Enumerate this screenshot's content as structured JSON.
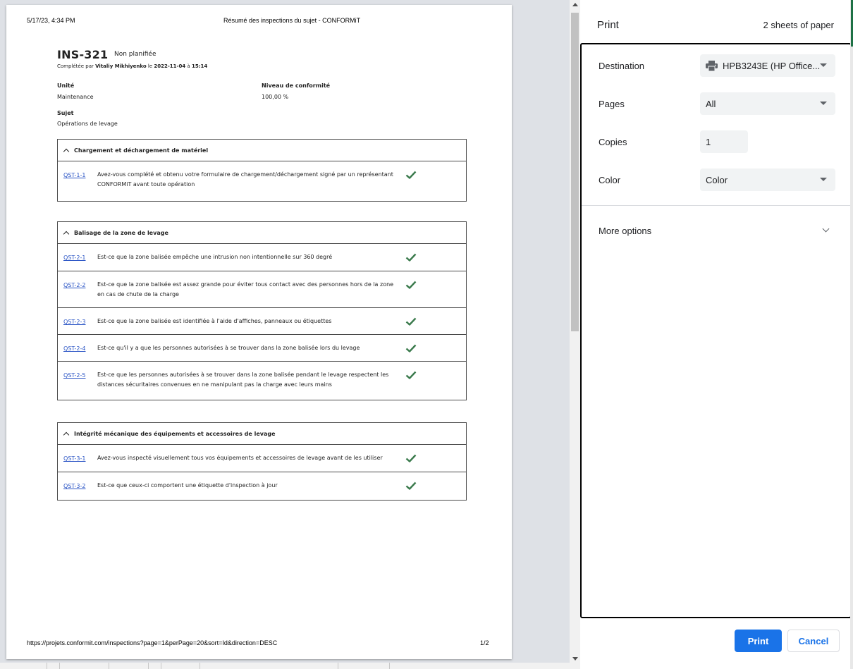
{
  "preview": {
    "header_date": "5/17/23, 4:34 PM",
    "header_title": "Résumé des inspections du sujet - CONFORMiT",
    "footer_url": "https://projets.conformit.com/inspections?page=1&perPage=20&sort=Id&direction=DESC",
    "footer_page": "1/2",
    "inspection": {
      "id": "INS-321",
      "status": "Non planifiée",
      "completed_prefix": "Complétée par",
      "completed_by": "Vitaliy Mikhiyenko",
      "completed_on": "le",
      "date": "2022-11-04",
      "at": "à",
      "time": "15:14",
      "unit_label": "Unité",
      "unit_value": "Maintenance",
      "conformity_label": "Niveau de conformité",
      "conformity_value": "100,00 %",
      "subject_label": "Sujet",
      "subject_value": "Opérations de levage"
    },
    "sections": [
      {
        "title": "Chargement et déchargement de matériel",
        "questions": [
          {
            "code": "QST-1-1",
            "text": "Avez-vous complété et obtenu votre formulaire de chargement/déchargement signé par un représentant CONFORMiT avant toute opération"
          }
        ]
      },
      {
        "title": "Balisage de la zone de levage",
        "questions": [
          {
            "code": "QST-2-1",
            "text": "Est-ce que la zone balisée empêche une intrusion non intentionnelle sur 360 degré"
          },
          {
            "code": "QST-2-2",
            "text": "Est-ce que la zone balisée est assez grande pour éviter tous contact avec des personnes hors de la zone en cas de chute de la charge"
          },
          {
            "code": "QST-2-3",
            "text": "Est-ce que la zone balisée est identifiée à l'aide d'affiches, panneaux ou étiquettes"
          },
          {
            "code": "QST-2-4",
            "text": "Est-ce qu'il y a que les personnes autorisées à se trouver dans la zone balisée lors du levage"
          },
          {
            "code": "QST-2-5",
            "text": "Est-ce que les personnes autorisées à se trouver dans la zone balisée pendant le levage respectent les distances sécuritaires convenues en ne manipulant pas la charge avec leurs mains"
          }
        ]
      },
      {
        "title": "Intégrité mécanique des équipements et accessoires de levage",
        "questions": [
          {
            "code": "QST-3-1",
            "text": "Avez-vous inspecté visuellement tous vos équipements et accessoires de levage avant de les utiliser"
          },
          {
            "code": "QST-3-2",
            "text": "Est-ce que ceux-ci comportent une étiquette d'inspection à jour"
          }
        ]
      }
    ],
    "check_icon": "check-icon",
    "check_color": "#3a7a4c"
  },
  "print_panel": {
    "title": "Print",
    "sheets": "2 sheets of paper",
    "destination_label": "Destination",
    "destination_value": "HPB3243E (HP Office...",
    "destination_icon": "printer-icon",
    "pages_label": "Pages",
    "pages_value": "All",
    "copies_label": "Copies",
    "copies_value": "1",
    "color_label": "Color",
    "color_value": "Color",
    "more_options": "More options",
    "print_button": "Print",
    "cancel_button": "Cancel",
    "accent_color": "#1a73e8"
  }
}
